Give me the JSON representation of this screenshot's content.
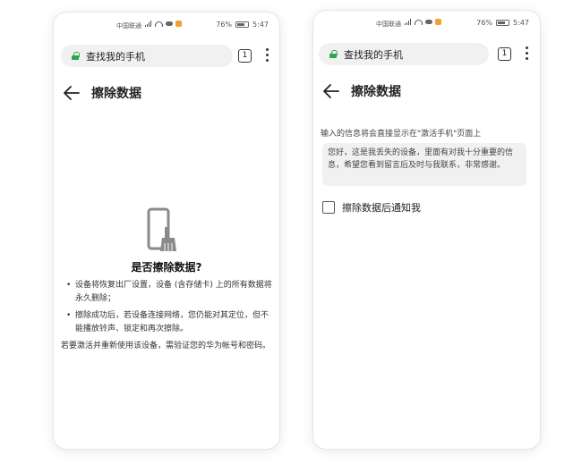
{
  "status": {
    "carrier": "中国联通",
    "battery": "76%",
    "time": "5:47"
  },
  "browser": {
    "url_title": "查找我的手机",
    "tab_count": "1"
  },
  "left_screen": {
    "title": "擦除数据",
    "icon": "phone-brush-icon",
    "confirm_title": "是否擦除数据?",
    "bullets": [
      "设备将恢复出厂设置，设备 (含存储卡) 上的所有数据将永久删除；",
      "擦除成功后，若设备连接网络，您仍能对其定位，但不能播放铃声、锁定和再次擦除。"
    ],
    "note": "若要激活并重新使用该设备，需验证您的华为帐号和密码。"
  },
  "right_screen": {
    "title": "擦除数据",
    "info_label": "输入的信息将会直接显示在\"激活手机\"页面上",
    "message": "您好，这是我丢失的设备，里面有对我十分重要的信息，希望您看到留言后及时与我联系，非常感谢。",
    "checkbox_label": "擦除数据后通知我",
    "checkbox_checked": false
  },
  "colors": {
    "lock": "#2ba84a",
    "icon_gray": "#8a8a8a"
  }
}
